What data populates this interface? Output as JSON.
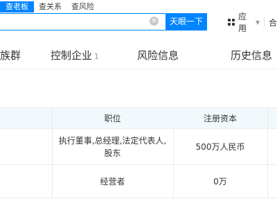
{
  "search_tabs": [
    "查老板",
    "查关系",
    "查风险"
  ],
  "search": {
    "value": "",
    "button_label": "天眼一下"
  },
  "header_right": {
    "app_label": "应用",
    "cut_label": "合"
  },
  "nav": {
    "items": [
      {
        "label": "族群"
      },
      {
        "label": "控制企业",
        "count": "1"
      },
      {
        "label": "风险信息"
      },
      {
        "label": "历史信息"
      }
    ]
  },
  "table": {
    "headers": {
      "position": "职位",
      "capital": "注册资本"
    },
    "rows": [
      {
        "position_line1": "执行董事,总经理,法定代表人,",
        "position_line2": "股东",
        "capital": "500万人民币"
      },
      {
        "position_line1": "经营者",
        "position_line2": "",
        "capital": "0万"
      }
    ]
  },
  "colors": {
    "accent": "#0084ff",
    "header_bg": "#f2f9fc"
  }
}
